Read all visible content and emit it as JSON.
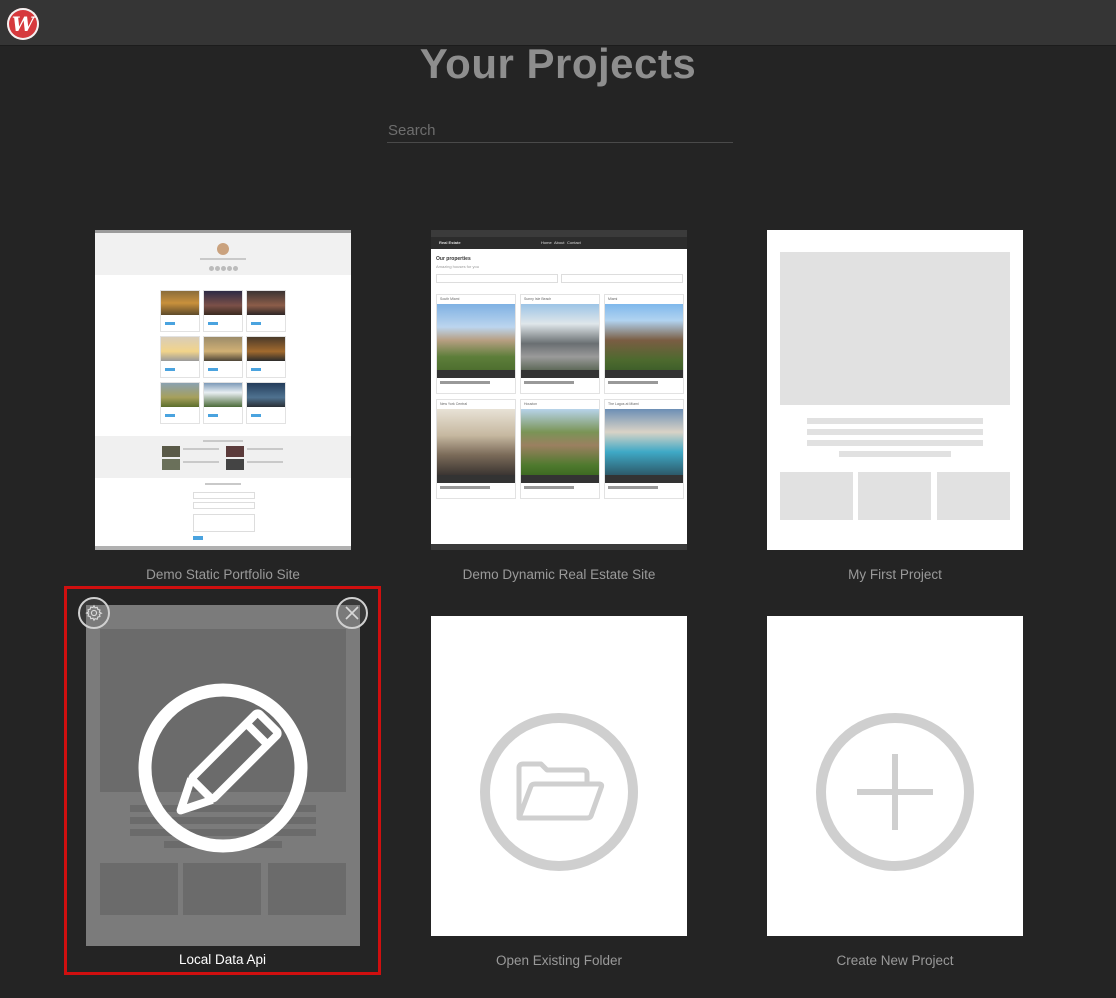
{
  "app": {
    "logo_icon": "app-logo-w",
    "logo_letter": "W"
  },
  "page": {
    "title": "Your Projects"
  },
  "search": {
    "placeholder": "Search",
    "value": ""
  },
  "projects": [
    {
      "label": "Demo Static Portfolio Site",
      "thumbnail": "portfolio-preview"
    },
    {
      "label": "Demo Dynamic Real Estate Site",
      "thumbnail": "real-estate-preview"
    },
    {
      "label": "My First Project",
      "thumbnail": "blank-template-preview"
    },
    {
      "label": "Local Data Api",
      "thumbnail": "blank-template-preview",
      "selected": true,
      "overlay_icon": "pencil-icon",
      "actions": [
        "gear-icon",
        "close-icon"
      ]
    },
    {
      "label": "Open Existing Folder",
      "icon": "folder-open-icon"
    },
    {
      "label": "Create New Project",
      "icon": "plus-icon"
    }
  ],
  "thumbnails": {
    "real_estate": {
      "brand": "Real Estate",
      "nav": [
        "Home",
        "About",
        "Contact"
      ],
      "heading": "Our properties",
      "subheading": "Amazing houses for you",
      "listings": [
        {
          "name": "South Miami",
          "price": "$ 500,000"
        },
        {
          "name": "Sunny Isle Beach",
          "price": "$ 500,000"
        },
        {
          "name": "Miami",
          "price": "$ 500,000"
        },
        {
          "name": "New York Central",
          "price": "$ 500,000"
        },
        {
          "name": "Houston",
          "price": "$ 500,000"
        },
        {
          "name": "The Lagos at Miami",
          "price": "$ 500,000"
        }
      ]
    }
  },
  "colors": {
    "selected_border": "#cf0f0f",
    "background": "#242424",
    "logo": "#d6393d"
  }
}
